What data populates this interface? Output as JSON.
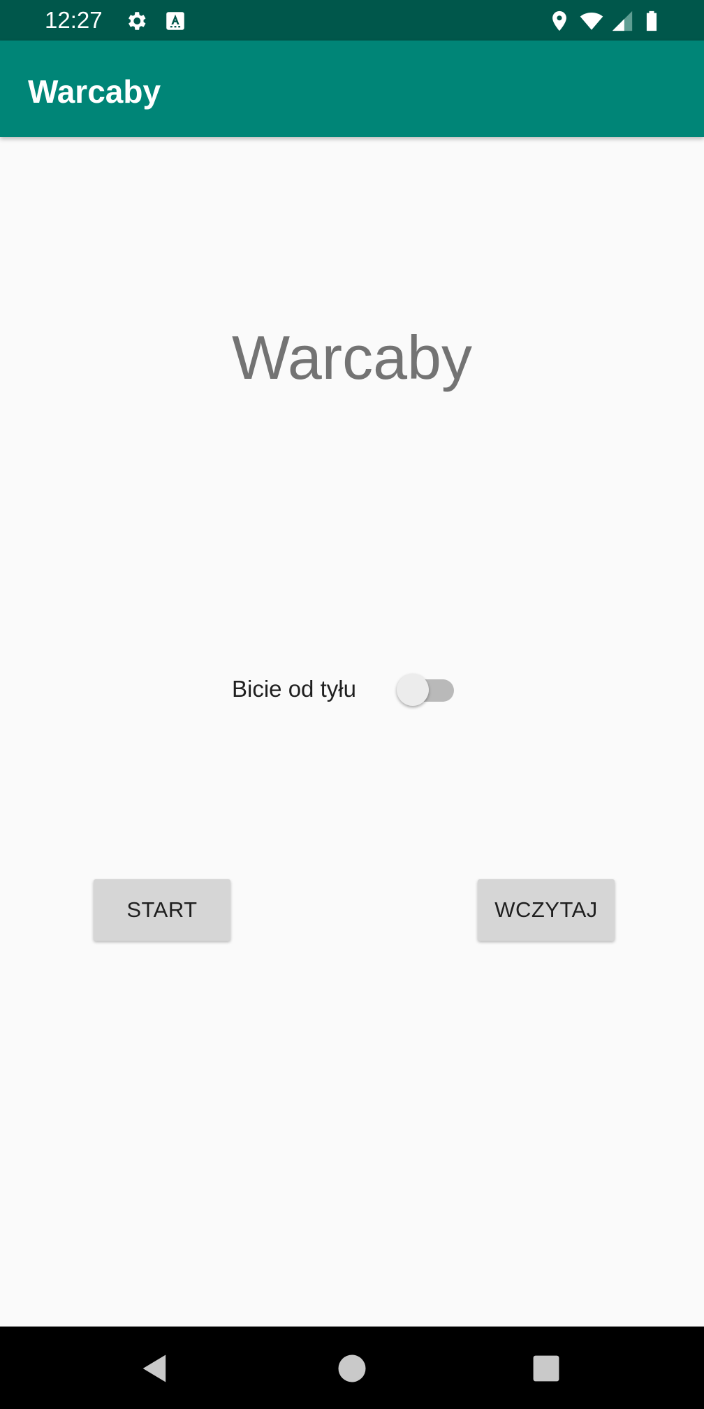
{
  "status_bar": {
    "time": "12:27",
    "left_icons": [
      "gear-icon",
      "keyboard-a-icon"
    ],
    "right_icons": [
      "location-icon",
      "wifi-icon",
      "signal-icon",
      "battery-icon"
    ],
    "background": "#00574b"
  },
  "app_bar": {
    "title": "Warcaby",
    "background": "#008577"
  },
  "main": {
    "title": "Warcaby",
    "toggle": {
      "label": "Bicie od tyłu",
      "checked": false
    },
    "buttons": {
      "start_label": "START",
      "load_label": "WCZYTAJ"
    }
  },
  "nav_bar": {
    "buttons": [
      "back-icon",
      "home-icon",
      "recents-icon"
    ]
  }
}
